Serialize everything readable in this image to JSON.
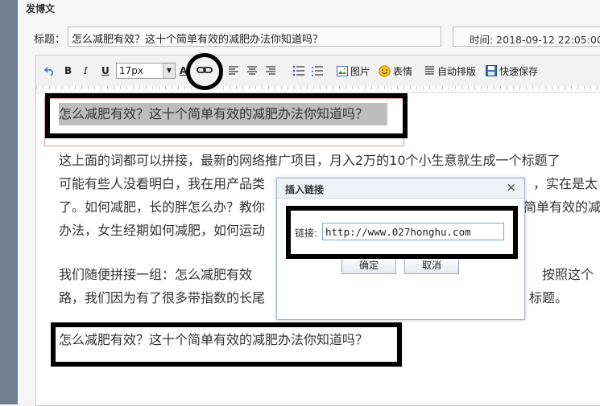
{
  "panel": {
    "title": "发博文"
  },
  "title_field": {
    "label": "标题：",
    "value": "怎么减肥有效？这十个简单有效的减肥办法你知道吗？"
  },
  "time_field": {
    "text": "时间: 2018-09-12 22:05:00"
  },
  "toolbar": {
    "undo_icon": "undo-icon",
    "bold": "B",
    "italic": "I",
    "underline": "U",
    "font_size": "17px",
    "font_color": "A",
    "image_label": "图片",
    "emoji_label": "表情",
    "autoformat_label": "自动排版",
    "quicksave_label": "快速保存"
  },
  "content": {
    "first_line": "怎么减肥有效？这十个简单有效的减肥办法你知道吗？",
    "para1": [
      "这上面的词都可以拼接，最新的网络推广项目，月入2万的10个小生意就生成一个标题了",
      "可能有些人没看明白，我在用产品类",
      "了。如何减肥，长的胖怎么办？教你",
      "办法，女生经期如何减肥，如何运动"
    ],
    "para1_right": [
      "",
      "，实在是太",
      "简单有效的减",
      ""
    ],
    "para2": [
      "我们随便拼接一组：怎么减肥有效",
      "路，我们因为有了很多带指数的长尾"
    ],
    "para2_right": [
      "按照这个",
      "标题。"
    ],
    "last_line": "怎么减肥有效？这十个简单有效的减肥办法你知道吗？"
  },
  "dialog": {
    "title": "插入链接",
    "close": "×",
    "link_label": "链接:",
    "link_value": "http://www.027honghu.com",
    "confirm": "确定",
    "cancel": "取消"
  },
  "colors": {
    "annotation": "#000000",
    "highlight": "#bdbdbd",
    "accent": "#7fa4cc"
  }
}
